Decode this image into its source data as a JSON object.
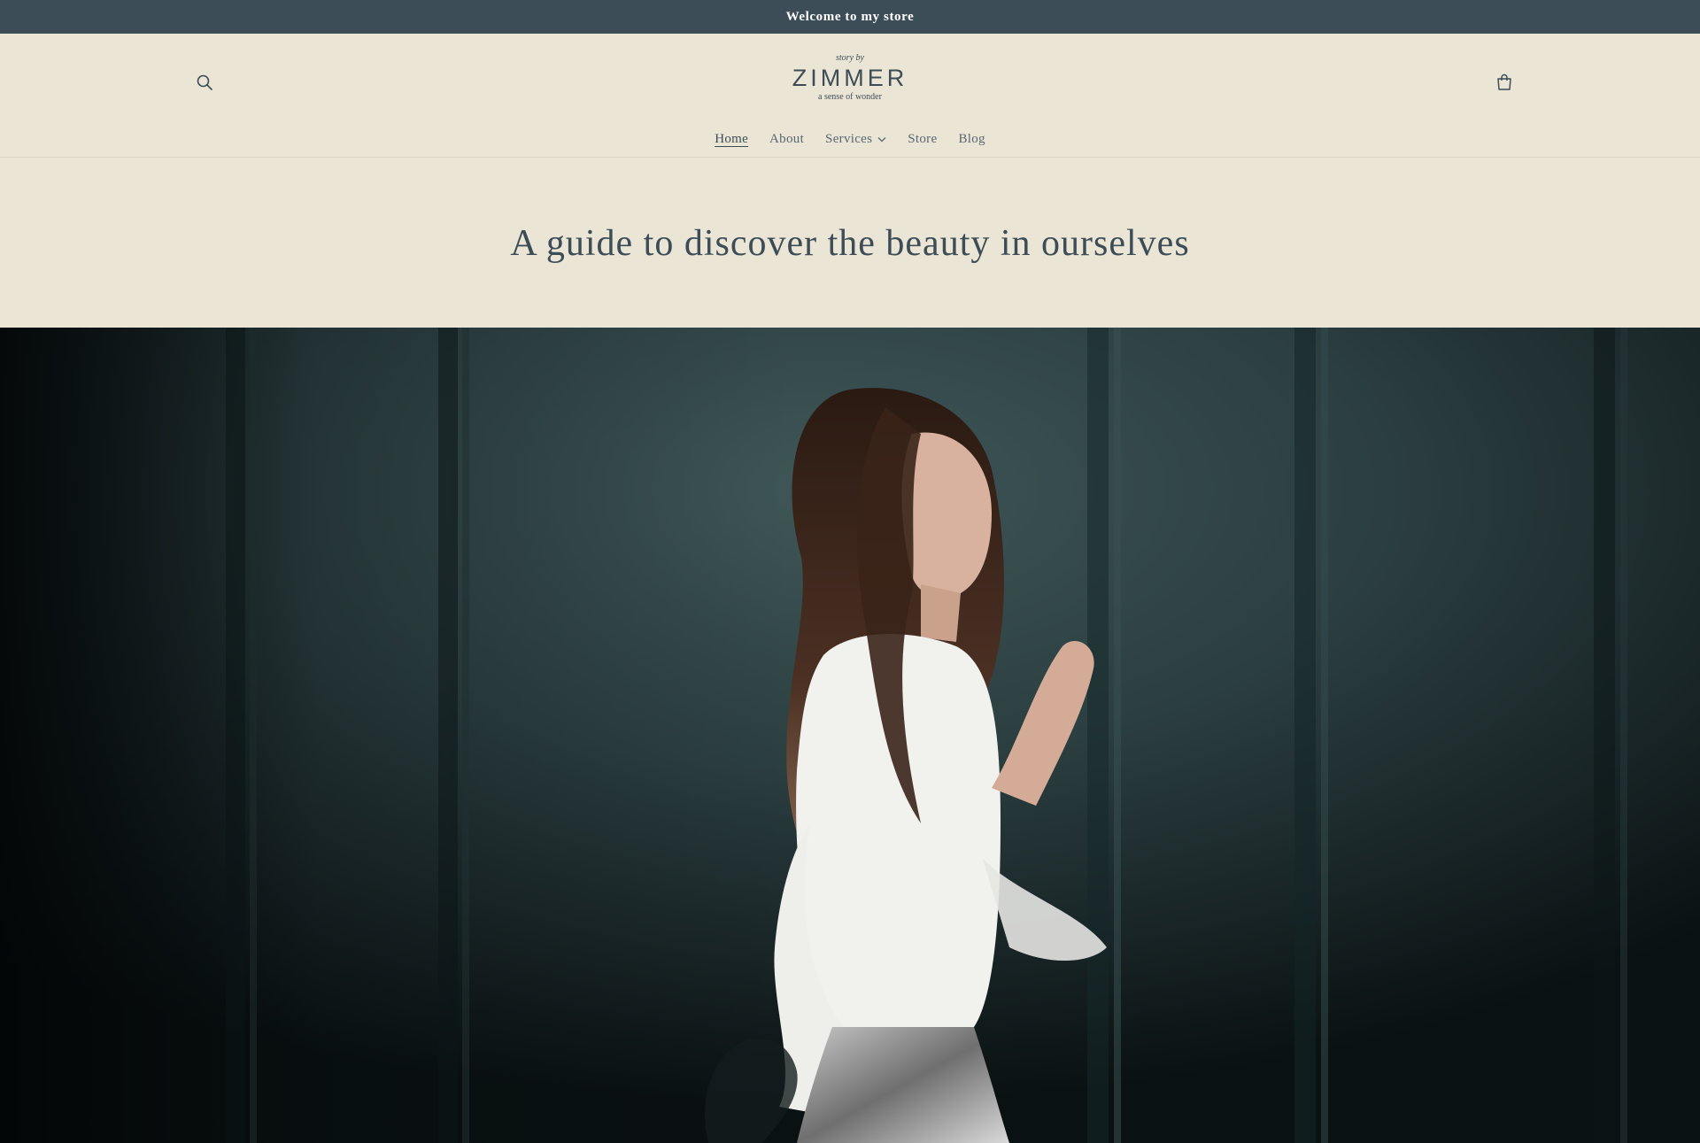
{
  "announcement": {
    "text": "Welcome to my store"
  },
  "header": {
    "logo": {
      "top": "story by",
      "main": "ZIMMER",
      "sub": "a sense of wonder"
    },
    "search_icon": "search-icon",
    "cart_icon": "cart-icon"
  },
  "nav": {
    "items": [
      {
        "label": "Home",
        "active": true
      },
      {
        "label": "About"
      },
      {
        "label": "Services",
        "has_dropdown": true
      },
      {
        "label": "Store"
      },
      {
        "label": "Blog"
      }
    ]
  },
  "hero": {
    "title": "A guide to discover the beauty in ourselves"
  },
  "colors": {
    "announcement_bg": "#3c4d57",
    "page_bg": "#ebe5d6",
    "text_primary": "#3c4d57",
    "image_wall": "#27393b"
  }
}
